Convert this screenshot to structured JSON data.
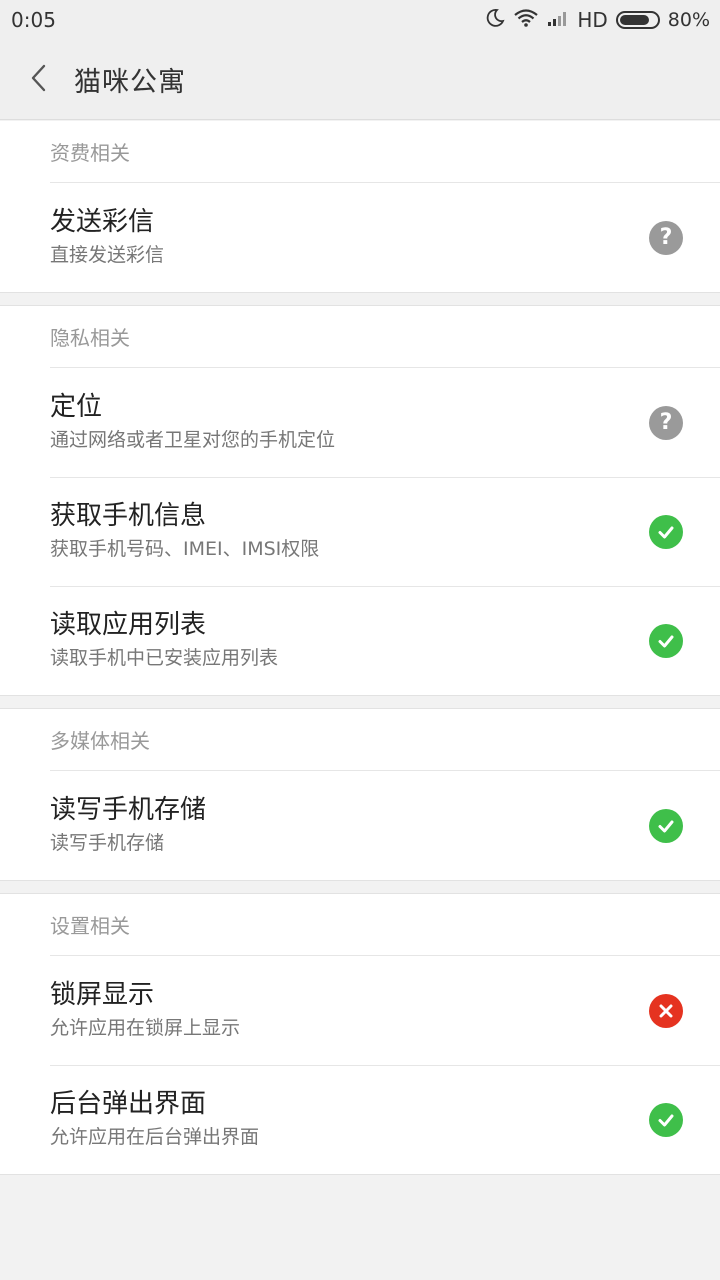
{
  "status_bar": {
    "time": "0:05",
    "network": "HD",
    "battery_percent": "80%",
    "battery_level": 0.8,
    "icons": [
      "moon-icon",
      "wifi-icon",
      "signal-icon",
      "battery-icon"
    ]
  },
  "header": {
    "title": "猫咪公寓",
    "back_icon": "chevron-left-icon"
  },
  "colors": {
    "unknown": "#9a9a9a",
    "allowed": "#3fbf4a",
    "denied": "#e53320"
  },
  "sections": [
    {
      "title": "资费相关",
      "items": [
        {
          "title": "发送彩信",
          "desc": "直接发送彩信",
          "status": "unknown"
        }
      ]
    },
    {
      "title": "隐私相关",
      "items": [
        {
          "title": "定位",
          "desc": "通过网络或者卫星对您的手机定位",
          "status": "unknown"
        },
        {
          "title": "获取手机信息",
          "desc": "获取手机号码、IMEI、IMSI权限",
          "status": "allowed"
        },
        {
          "title": "读取应用列表",
          "desc": "读取手机中已安装应用列表",
          "status": "allowed"
        }
      ]
    },
    {
      "title": "多媒体相关",
      "items": [
        {
          "title": "读写手机存储",
          "desc": "读写手机存储",
          "status": "allowed"
        }
      ]
    },
    {
      "title": "设置相关",
      "items": [
        {
          "title": "锁屏显示",
          "desc": "允许应用在锁屏上显示",
          "status": "denied"
        },
        {
          "title": "后台弹出界面",
          "desc": "允许应用在后台弹出界面",
          "status": "allowed"
        }
      ]
    }
  ]
}
